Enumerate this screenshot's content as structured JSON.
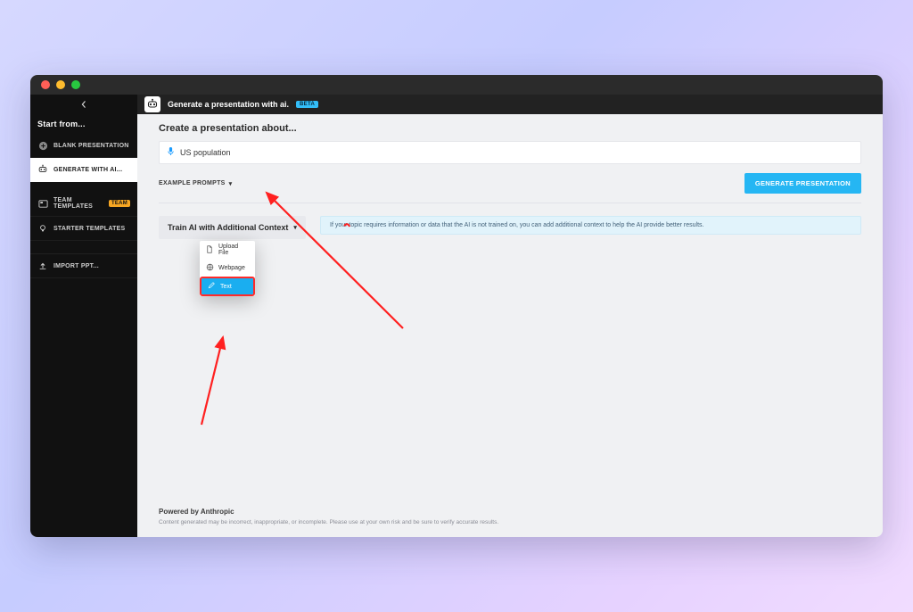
{
  "header": {
    "title": "Generate a presentation with ai.",
    "beta_label": "BETA"
  },
  "sidebar": {
    "section_title": "Start from...",
    "items": [
      {
        "label": "BLANK PRESENTATION"
      },
      {
        "label": "GENERATE WITH AI..."
      },
      {
        "label": "TEAM TEMPLATES",
        "badge": "TEAM"
      },
      {
        "label": "STARTER TEMPLATES"
      },
      {
        "label": "IMPORT PPT..."
      }
    ]
  },
  "create": {
    "heading": "Create a presentation about...",
    "prompt_value": "US population",
    "example_prompts_label": "EXAMPLE PROMPTS",
    "generate_button": "GENERATE PRESENTATION"
  },
  "train": {
    "toggle_label": "Train AI with Additional Context",
    "info_text": "If your topic requires information or data that the AI is not trained on, you can add additional context to help the AI provide better results.",
    "options": {
      "upload_file": "Upload File",
      "webpage": "Webpage",
      "text": "Text"
    }
  },
  "footer": {
    "powered": "Powered by Anthropic",
    "disclaimer": "Content generated may be incorrect, inappropriate, or incomplete. Please use at your own risk and be sure to verify accurate results."
  }
}
